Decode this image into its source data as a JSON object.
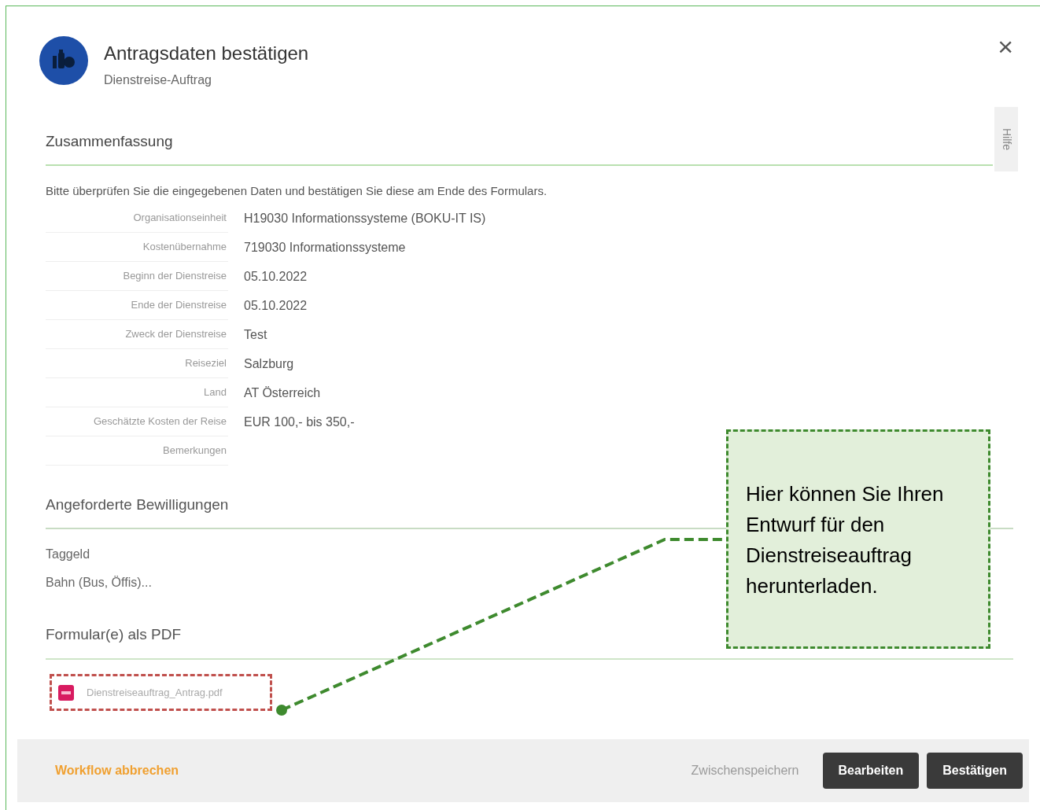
{
  "dialog": {
    "title": "Antragsdaten bestätigen",
    "subtitle": "Dienstreise-Auftrag",
    "close_label": "×",
    "help_tab": "Hilfe"
  },
  "summary": {
    "heading": "Zusammenfassung",
    "intro": "Bitte überprüfen Sie die eingegebenen Daten und bestätigen Sie diese am Ende des Formulars.",
    "fields": [
      {
        "label": "Organisationseinheit",
        "value": "H19030 Informationssysteme (BOKU-IT IS)"
      },
      {
        "label": "Kostenübernahme",
        "value": "719030 Informationssysteme"
      },
      {
        "label": "Beginn der Dienstreise",
        "value": "05.10.2022"
      },
      {
        "label": "Ende der Dienstreise",
        "value": "05.10.2022"
      },
      {
        "label": "Zweck der Dienstreise",
        "value": "Test"
      },
      {
        "label": "Reiseziel",
        "value": "Salzburg"
      },
      {
        "label": "Land",
        "value": "AT Österreich"
      },
      {
        "label": "Geschätzte Kosten der Reise",
        "value": "EUR 100,- bis 350,-"
      },
      {
        "label": "Bemerkungen"
      }
    ]
  },
  "approvals": {
    "heading": "Angeforderte Bewilligungen",
    "items": [
      "Taggeld",
      "Bahn (Bus, Öffis)..."
    ]
  },
  "pdf": {
    "heading": "Formular(e) als PDF",
    "files": [
      "Dienstreiseauftrag_Antrag.pdf"
    ]
  },
  "footer": {
    "cancel": "Workflow abbrechen",
    "buttons": [
      {
        "label": "Zwischenspeichern",
        "disabled": true
      },
      {
        "label": "Bearbeiten",
        "disabled": false
      },
      {
        "label": "Bestätigen",
        "disabled": false
      }
    ]
  },
  "callout": {
    "text": "Hier können Sie Ihren Entwurf für den Dienstreiseauftrag herunterladen."
  }
}
